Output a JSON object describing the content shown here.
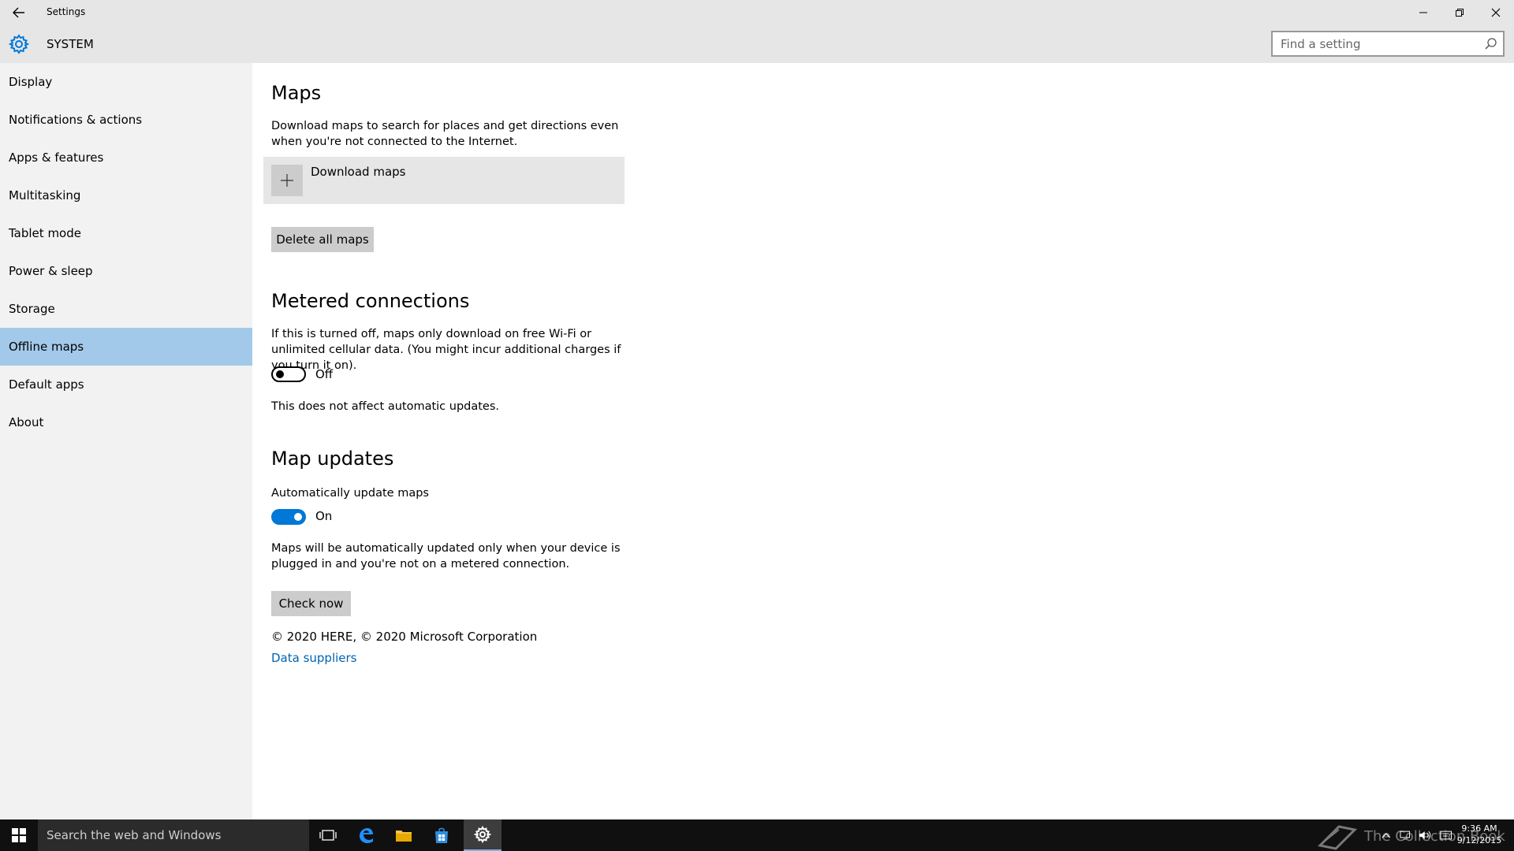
{
  "window": {
    "title": "Settings",
    "section_title": "SYSTEM"
  },
  "search": {
    "placeholder": "Find a setting"
  },
  "sidebar": {
    "items": [
      {
        "label": "Display"
      },
      {
        "label": "Notifications & actions"
      },
      {
        "label": "Apps & features"
      },
      {
        "label": "Multitasking"
      },
      {
        "label": "Tablet mode"
      },
      {
        "label": "Power & sleep"
      },
      {
        "label": "Storage"
      },
      {
        "label": "Offline maps",
        "active": true
      },
      {
        "label": "Default apps"
      },
      {
        "label": "About"
      }
    ]
  },
  "maps": {
    "heading": "Maps",
    "description": "Download maps to search for places and get directions even when you're not connected to the Internet.",
    "download_label": "Download maps",
    "delete_label": "Delete all maps"
  },
  "metered": {
    "heading": "Metered connections",
    "description": "If this is turned off, maps only download on free Wi-Fi or unlimited cellular data. (You might incur additional charges if you turn it on).",
    "toggle_state": "Off",
    "note": "This does not affect automatic updates."
  },
  "updates": {
    "heading": "Map updates",
    "auto_label": "Automatically update maps",
    "toggle_state": "On",
    "description": "Maps will be automatically updated only when your device is plugged in and you're not on a metered connection.",
    "check_label": "Check now"
  },
  "footer": {
    "copyright": "© 2020 HERE, © 2020 Microsoft Corporation",
    "link": "Data suppliers"
  },
  "taskbar": {
    "search_text": "Search the web and Windows",
    "time": "9:36 AM",
    "date": "9/12/2015",
    "watermark": "The Collection Book"
  },
  "colors": {
    "accent": "#0078d7",
    "selected_nav": "#a3c9ea",
    "link": "#0063b1"
  }
}
